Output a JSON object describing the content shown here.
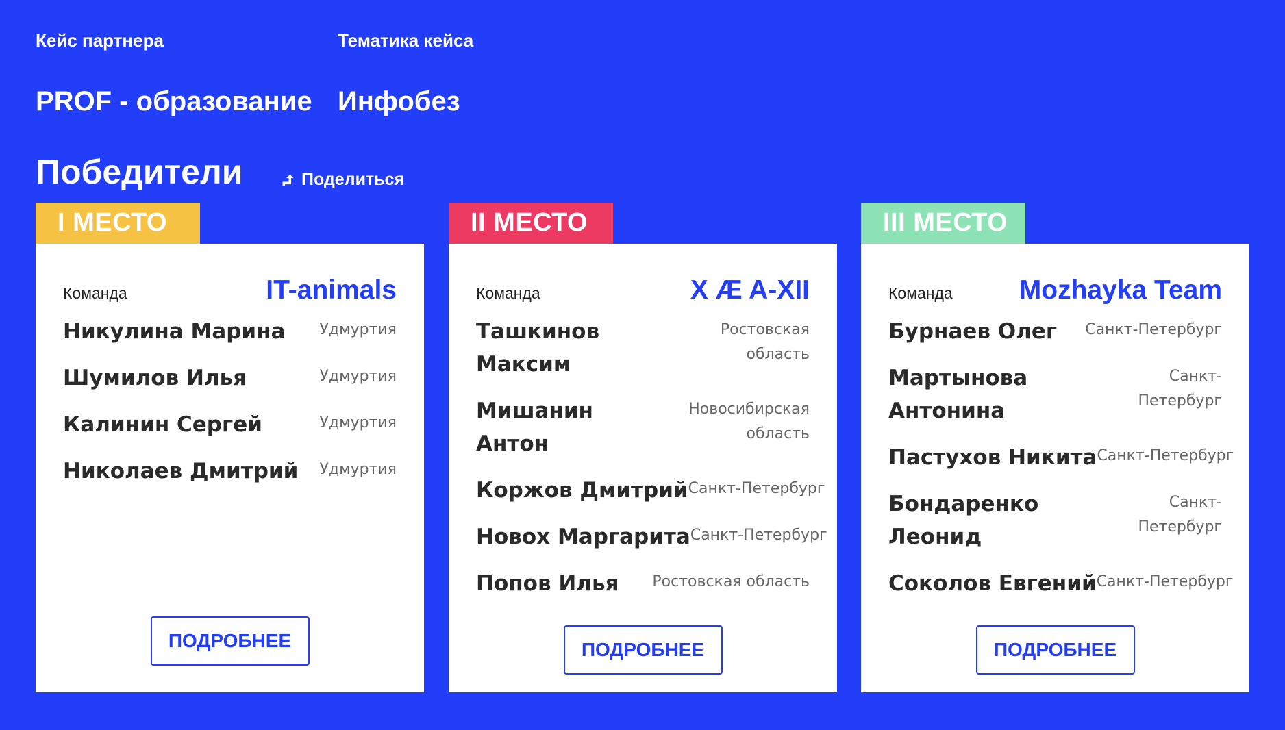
{
  "header": {
    "partner_label": "Кейс партнера",
    "partner_value": "PROF - образование",
    "topic_label": "Тематика кейса",
    "topic_value": "Инфобез"
  },
  "winners": {
    "title": "Победители",
    "share_label": "Поделиться"
  },
  "colors": {
    "background": "#233ef8",
    "first": "#f6c244",
    "second": "#ec3a62",
    "third": "#8ee3b6"
  },
  "places": [
    {
      "label": "I МЕСТО",
      "team_label": "Команда",
      "team_name": "IT-animals",
      "button": "ПОДРОБНЕЕ",
      "members": [
        {
          "name": "Никулина Марина",
          "region": "Удмуртия"
        },
        {
          "name": "Шумилов Илья",
          "region": "Удмуртия"
        },
        {
          "name": "Калинин Сергей",
          "region": "Удмуртия"
        },
        {
          "name": "Николаев Дмитрий",
          "region": "Удмуртия"
        }
      ]
    },
    {
      "label": "II МЕСТО",
      "team_label": "Команда",
      "team_name": "X Æ A-XII",
      "button": "ПОДРОБНЕЕ",
      "members": [
        {
          "name": "Ташкинов Максим",
          "region": "Ростовская область"
        },
        {
          "name": "Мишанин Антон",
          "region": "Новосибирская область"
        },
        {
          "name": "Коржов Дмитрий",
          "region": "Санкт-Петербург"
        },
        {
          "name": "Новох Маргарита",
          "region": "Санкт-Петербург"
        },
        {
          "name": "Попов Илья",
          "region": "Ростовская область"
        }
      ]
    },
    {
      "label": "III МЕСТО",
      "team_label": "Команда",
      "team_name": "Mozhayka Team",
      "button": "ПОДРОБНЕЕ",
      "members": [
        {
          "name": "Бурнаев Олег",
          "region": "Санкт-Петербург"
        },
        {
          "name": "Мартынова Антонина",
          "region": "Санкт-Петербург"
        },
        {
          "name": "Пастухов Никита",
          "region": "Санкт-Петербург"
        },
        {
          "name": "Бондаренко Леонид",
          "region": "Санкт-Петербург"
        },
        {
          "name": "Соколов Евгений",
          "region": "Санкт-Петербург"
        }
      ]
    }
  ]
}
